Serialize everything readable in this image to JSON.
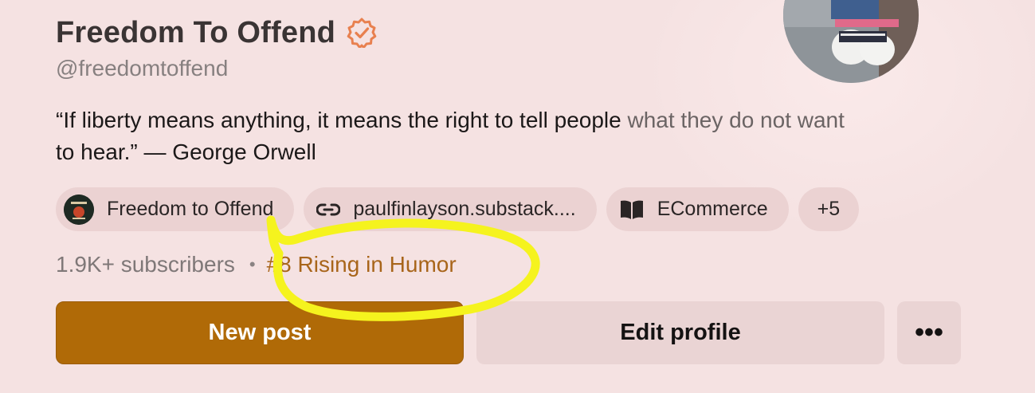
{
  "profile": {
    "name": "Freedom To Offend",
    "handle": "@freedomtoffend",
    "bio_main": "“If liberty means anything, it means the right to tell people ",
    "bio_muted": "what they do not want",
    "bio_end": "to hear.” — George Orwell"
  },
  "chips": [
    {
      "label": "Freedom to Offend",
      "icon": "publication-logo-icon"
    },
    {
      "label": "paulfinlayson.substack....",
      "icon": "link-icon"
    },
    {
      "label": "ECommerce",
      "icon": "book-open-icon"
    },
    {
      "label": "+5"
    }
  ],
  "stats": {
    "subscribers": "1.9K+ subscribers",
    "separator": "•",
    "rank": "#8 Rising in Humor"
  },
  "actions": {
    "primary": "New post",
    "secondary": "Edit profile",
    "more": "•••"
  },
  "colors": {
    "background": "#f5e2e2",
    "accent": "#b06a07",
    "verified": "#e8804f",
    "highlight_scribble": "#f5f31e"
  }
}
